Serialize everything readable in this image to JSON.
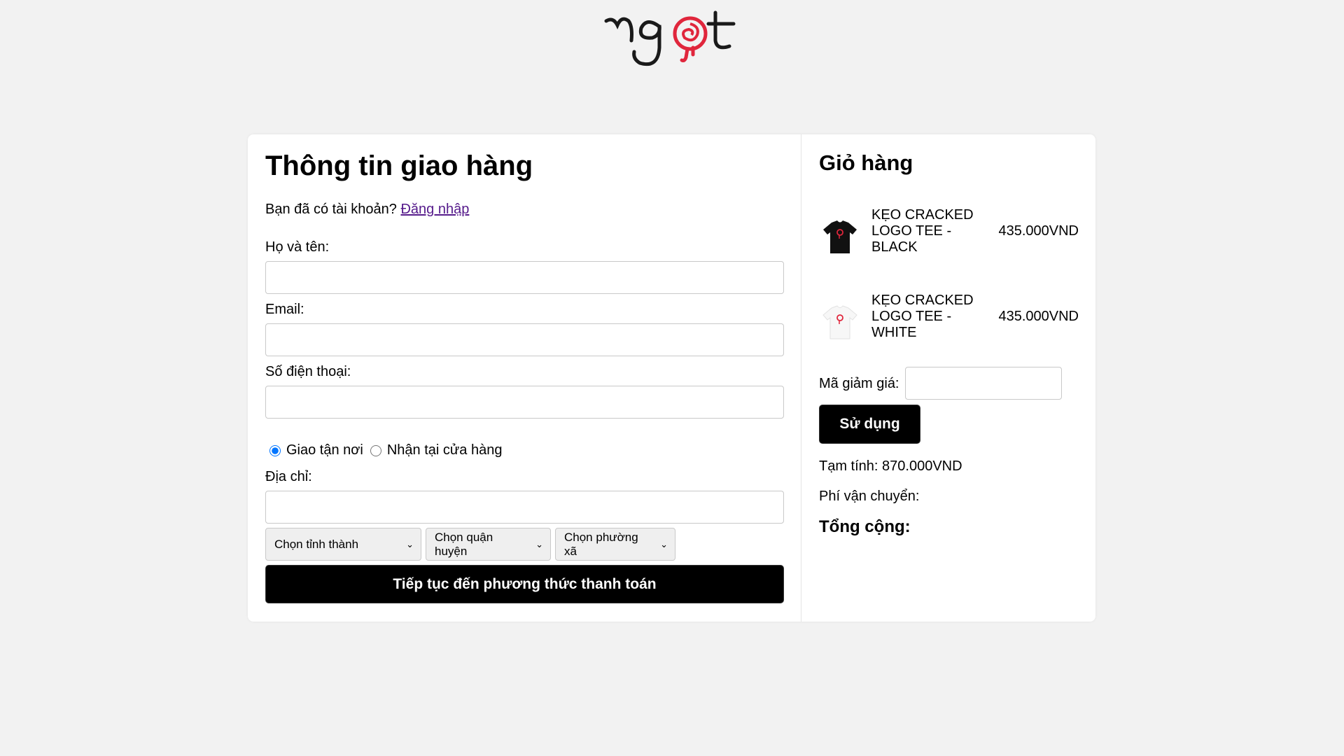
{
  "brand": {
    "logo_text": "ngot"
  },
  "shipping_form": {
    "title": "Thông tin giao hàng",
    "login_prompt": "Bạn đã có tài khoản?",
    "login_link": "Đăng nhập",
    "fields": {
      "fullname": {
        "label": "Họ và tên:",
        "value": ""
      },
      "email": {
        "label": "Email:",
        "value": ""
      },
      "phone": {
        "label": "Số điện thoại:",
        "value": ""
      },
      "address": {
        "label": "Địa chỉ:",
        "value": ""
      }
    },
    "delivery_options": [
      {
        "label": "Giao tận nơi",
        "selected": true
      },
      {
        "label": "Nhận tại cửa hàng",
        "selected": false
      }
    ],
    "selects": {
      "province": "Chọn tỉnh thành",
      "district": "Chọn quận huyện",
      "ward": "Chọn phường xã"
    },
    "continue_label": "Tiếp tục đến phương thức thanh toán"
  },
  "cart": {
    "title": "Giỏ hàng",
    "items": [
      {
        "name": "KẸO CRACKED LOGO TEE - BLACK",
        "price": "435.000VND",
        "color": "#111111"
      },
      {
        "name": "KẸO CRACKED LOGO TEE - WHITE",
        "price": "435.000VND",
        "color": "#f7f7f7"
      }
    ],
    "coupon_label": "Mã giảm giá:",
    "coupon_value": "",
    "apply_label": "Sử dụng",
    "subtotal": "Tạm tính: 870.000VND",
    "shipping_fee": "Phí vận chuyển:",
    "total": "Tổng cộng:"
  },
  "colors": {
    "accent_red": "#e0263c",
    "button_bg": "#000000",
    "page_bg": "#f2f2f2"
  }
}
